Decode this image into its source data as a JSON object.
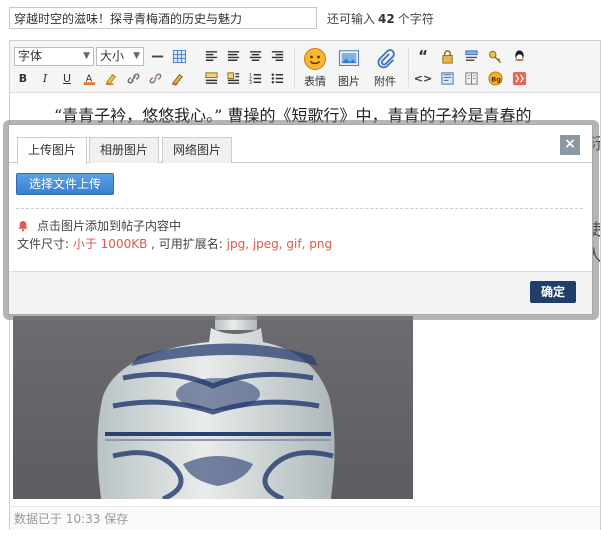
{
  "title_input": {
    "value": "穿越时空的滋味！探寻青梅酒的历史与魅力"
  },
  "char_hint": {
    "prefix": "还可输入",
    "count": "42",
    "suffix": "个字符"
  },
  "toolbar": {
    "font_select": "字体",
    "size_select": "大小",
    "emoji_label": "表情",
    "image_label": "图片",
    "attachment_label": "附件"
  },
  "editor": {
    "paragraph": "“青青子衿，悠悠我心。” 曹操的《短歌行》中，青青的子衿是青春的",
    "frag_line2": "衍",
    "frag_line3": "使",
    "frag_line4": "人"
  },
  "dialog": {
    "tabs": [
      {
        "label": "上传图片"
      },
      {
        "label": "相册图片"
      },
      {
        "label": "网络图片"
      }
    ],
    "close_symbol": "×",
    "upload_button": "选择文件上传",
    "tip": "点击图片添加到帖子内容中",
    "size_prefix": "文件尺寸: ",
    "size_value": "小于 1000KB",
    "ext_prefix": " , 可用扩展名: ",
    "ext_value": "jpg, jpeg, gif, png",
    "confirm_button": "确定"
  },
  "status_bar": {
    "text": "数据已于 10:33 保存"
  },
  "colors": {
    "accent_blue": "#3a7fcf",
    "warn_red": "#e0584c",
    "confirm_navy": "#1f3f6a"
  }
}
